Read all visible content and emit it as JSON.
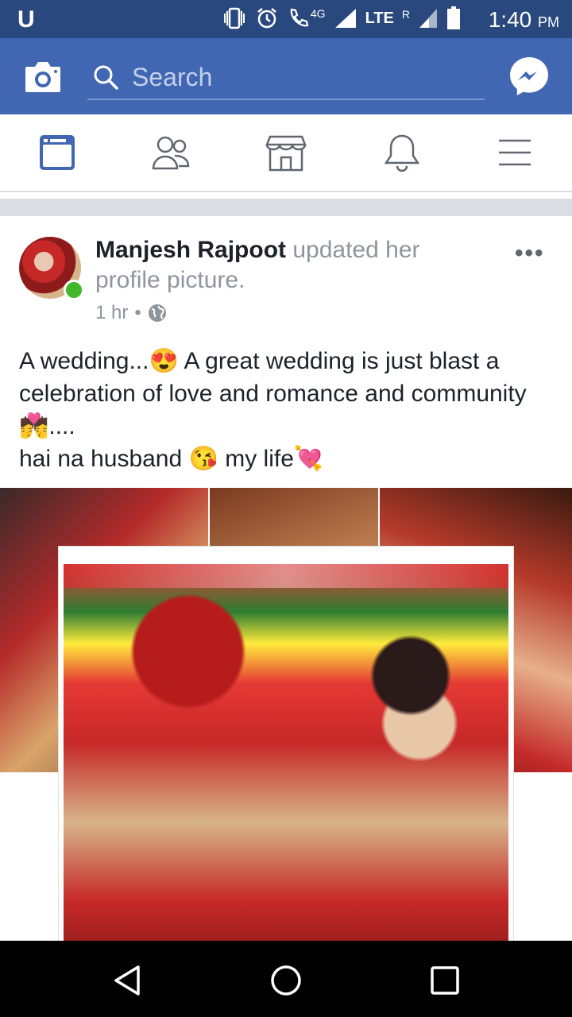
{
  "status_bar": {
    "carrier_glyph": "U",
    "network_label": "4G",
    "lte_label": "LTE",
    "roaming_label": "R",
    "time": "1:40",
    "ampm": "PM"
  },
  "header": {
    "search_placeholder": "Search"
  },
  "nav": {
    "items": [
      "news-feed",
      "friends",
      "marketplace",
      "notifications",
      "menu"
    ]
  },
  "post": {
    "author": "Manjesh Rajpoot",
    "action": "updated her profile picture.",
    "time": "1 hr",
    "separator": "•",
    "more": "•••",
    "text_line1": "A wedding...😍 A great wedding is just blast a celebration of love and romance and community 💏....",
    "text_line2": "hai na husband 😘 my life💘"
  },
  "colors": {
    "status_bar": "#29487d",
    "header": "#4267b2",
    "online": "#42b72a"
  }
}
